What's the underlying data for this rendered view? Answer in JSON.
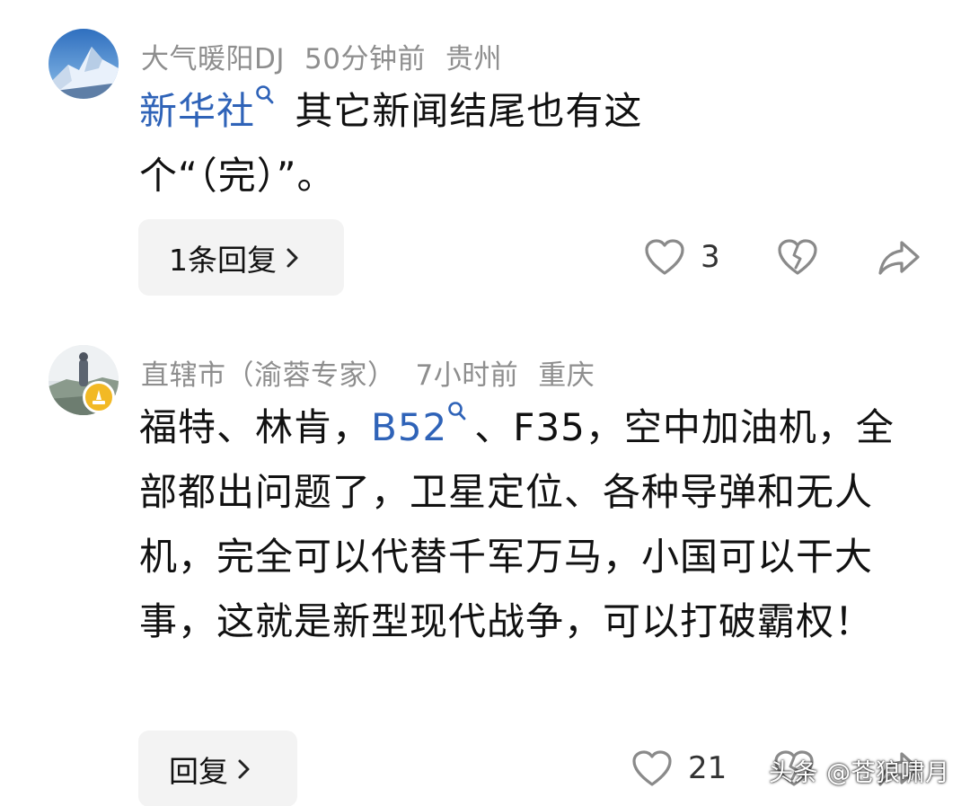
{
  "comments": [
    {
      "username": "大气暖阳DJ",
      "time": "50分钟前",
      "location": "贵州",
      "link_text": "新华社",
      "text_after_link": " 其它新闻结尾也有这个“（完）”。",
      "reply_label": "1条回复",
      "like_count": "3"
    },
    {
      "username": "直辖市（渝蓉专家）",
      "time": "7小时前",
      "location": "重庆",
      "text_before_link": "福特、林肯，",
      "link_text": "B52",
      "text_after_link": "、F35，空中加油机，全部都出问题了，卫星定位、各种导弹和无人机，完全可以代替千军万马，小国可以干大事，这就是新型现代战争，可以打破霸权！",
      "reply_label": "回复",
      "like_count": "21"
    }
  ],
  "watermark": "头条 @苍狼啸月",
  "colors": {
    "link": "#2f63b8",
    "meta": "#8e8e8e",
    "button_bg": "#f3f3f3",
    "badge": "#f2b925"
  }
}
